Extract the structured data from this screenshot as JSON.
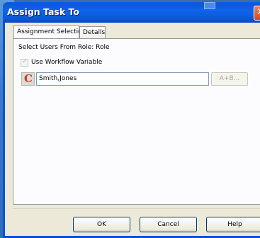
{
  "window": {
    "title": "Assign Task To"
  },
  "tabs": [
    {
      "label": "Assignment Selection",
      "active": true
    },
    {
      "label": "Details",
      "active": false
    }
  ],
  "panel": {
    "role_text": "Select Users From Role:  Role",
    "use_workflow_variable_label": "Use Workflow Variable",
    "use_workflow_variable_checked": true,
    "variable_icon_glyph": "C",
    "variable_value": "Smith,Jones",
    "expression_button_label": "A+B..."
  },
  "buttons": {
    "ok": "OK",
    "cancel": "Cancel",
    "help": "Help"
  },
  "colors": {
    "titlebar": "#0a58df",
    "client": "#ece9d8",
    "accent_tab": "#ffc83c"
  }
}
